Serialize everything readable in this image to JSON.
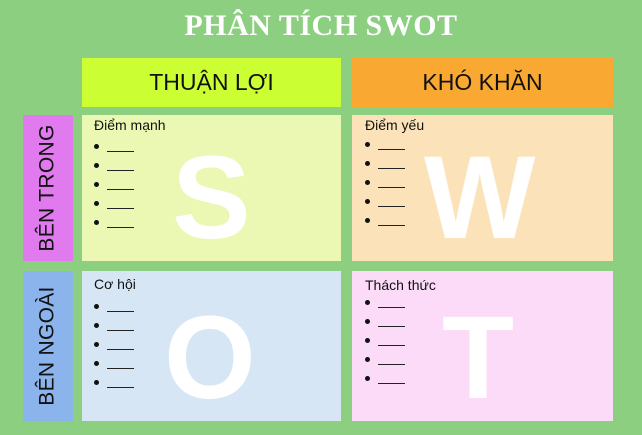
{
  "title": "PHÂN TÍCH SWOT",
  "columns": {
    "left": {
      "label": "THUẬN LỢI",
      "color": "#ccff33"
    },
    "right": {
      "label": "KHÓ KHĂN",
      "color": "#f9a832"
    }
  },
  "rows": {
    "top": {
      "label": "BÊN TRONG",
      "color": "#e07aee"
    },
    "bottom": {
      "label": "BÊN NGOÀI",
      "color": "#8bb4ec"
    }
  },
  "quadrants": {
    "s": {
      "letter": "S",
      "label": "Điểm mạnh",
      "bullet_count": 5,
      "color": "#eaf8b4"
    },
    "w": {
      "letter": "W",
      "label": "Điểm yếu",
      "bullet_count": 5,
      "color": "#fbe2b9"
    },
    "o": {
      "letter": "O",
      "label": "Cơ hội",
      "bullet_count": 5,
      "color": "#d7e6f4"
    },
    "t": {
      "letter": "T",
      "label": "Thách thức",
      "bullet_count": 5,
      "color": "#fbdbf8"
    }
  },
  "colors": {
    "background": "#8ccf80",
    "text": "#111111",
    "letter": "#ffffff"
  }
}
